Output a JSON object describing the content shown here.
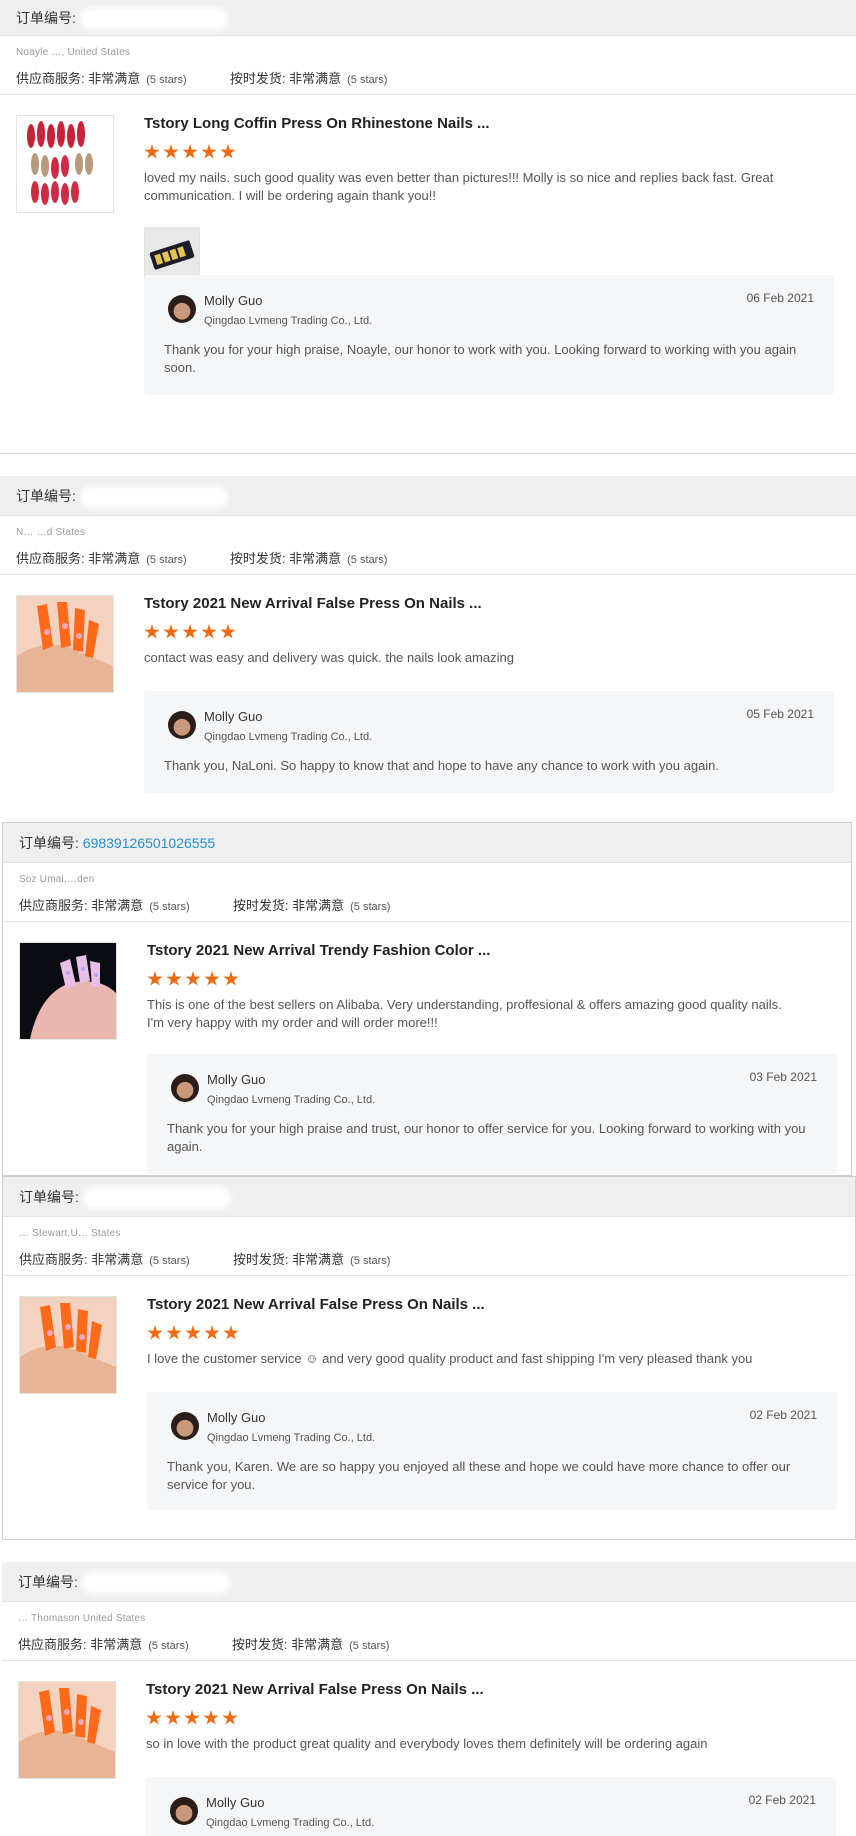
{
  "labels": {
    "order_prefix": "订单编号:",
    "supplier_service": "供应商服务:",
    "on_time_shipping": "按时发货:",
    "rating_value": "非常满意",
    "stars_text": "(5 stars)"
  },
  "colors": {
    "star": "#f06a13",
    "order_link": "#2a8ec9",
    "header_bg": "#efefef"
  },
  "reviews": [
    {
      "order_number": "6…25…1",
      "buyer_location": "Noayle …, United States",
      "product_title": "Tstory Long Coffin Press On Rhinestone Nails ...",
      "stars": 5,
      "review_text": "loved my nails. such good quality was even better than pictures!!! Molly is so nice and replies back fast. Great communication. I will be ordering again thank you!!",
      "has_attachment": true,
      "thumb_icon": "red-coffin-nails-image",
      "reply": {
        "name": "Molly Guo",
        "company": "Qingdao Lvmeng Trading Co., Ltd.",
        "date": "06 Feb 2021",
        "message": "Thank you for your high praise, Noayle, our honor to work with you. Looking forward to working with you again soon."
      }
    },
    {
      "order_number": "703956…",
      "buyer_location": "N… …d States",
      "product_title": "Tstory 2021 New Arrival False Press On Nails ...",
      "stars": 5,
      "review_text": "contact was easy and delivery was quick. the nails look amazing",
      "has_attachment": false,
      "thumb_icon": "orange-nails-image",
      "reply": {
        "name": "Molly Guo",
        "company": "Qingdao Lvmeng Trading Co., Ltd.",
        "date": "05 Feb 2021",
        "message": "Thank you, NaLoni. So happy to know that and hope to have any chance to work with you again."
      }
    },
    {
      "order_number": "69839126501026555",
      "buyer_location": "Soz Umai,…den",
      "product_title": "Tstory 2021 New Arrival Trendy Fashion Color ...",
      "stars": 5,
      "review_text": "This is one of the best sellers on Alibaba. Very understanding, proffesional & offers amazing good quality nails. I'm very happy with my order and will order more!!!",
      "has_attachment": false,
      "thumb_icon": "pink-nails-image",
      "reply": {
        "name": "Molly Guo",
        "company": "Qingdao Lvmeng Trading Co., Ltd.",
        "date": "03 Feb 2021",
        "message": "Thank you for your high praise and trust, our honor to offer service for you. Looking forward to working with you again."
      }
    },
    {
      "order_number": "…",
      "buyer_location": "… Stewart,U… States",
      "product_title": "Tstory 2021 New Arrival False Press On Nails ...",
      "stars": 5,
      "review_text": "I love the customer service ☺ and very good quality product and fast shipping I'm very pleased thank you",
      "has_attachment": false,
      "thumb_icon": "orange-nails-image",
      "reply": {
        "name": "Molly Guo",
        "company": "Qingdao Lvmeng Trading Co., Ltd.",
        "date": "02 Feb 2021",
        "message": "Thank you, Karen. We are so happy you enjoyed all these and hope we could have more chance to offer our service for you."
      }
    },
    {
      "order_number": "…781950…",
      "buyer_location": "… Thomason United States",
      "product_title": "Tstory 2021 New Arrival False Press On Nails ...",
      "stars": 5,
      "review_text": "so in love with the product great quality and everybody loves them definitely will be ordering again",
      "has_attachment": false,
      "thumb_icon": "orange-nails-image",
      "reply": {
        "name": "Molly Guo",
        "company": "Qingdao Lvmeng Trading Co., Ltd.",
        "date": "02 Feb 2021",
        "message": ""
      }
    }
  ]
}
